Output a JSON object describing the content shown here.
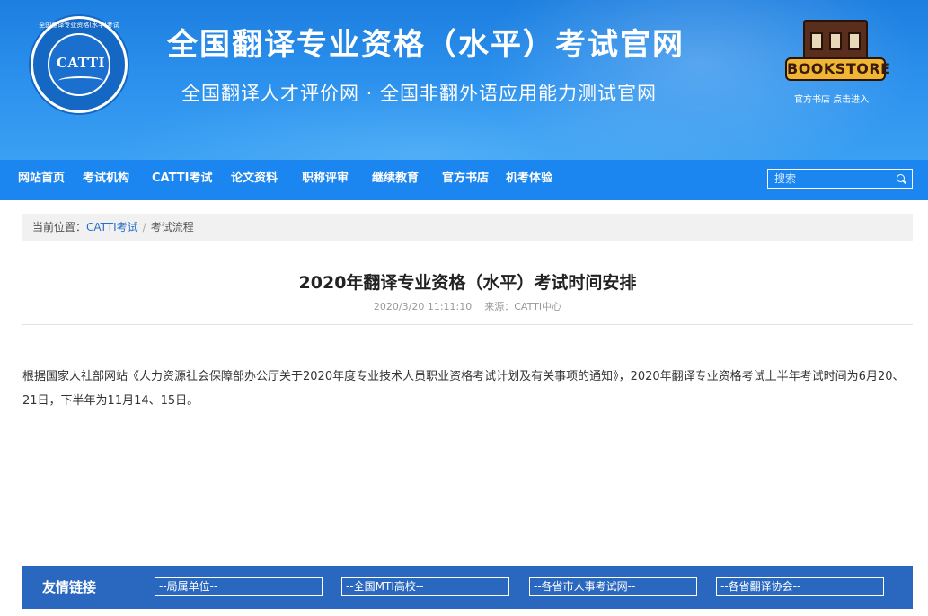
{
  "header": {
    "logo_text": "CATTI",
    "logo_ring_text": "全国翻译专业资格(水平)考试",
    "title": "全国翻译专业资格（水平）考试官网",
    "subtitle": "全国翻译人才评价网 · 全国非翻外语应用能力测试官网",
    "bookstore_sign": "BOOKSTORE",
    "bookstore_caption": "官方书店 点击进入"
  },
  "nav": {
    "items": [
      "网站首页",
      "考试机构",
      "CATTI考试",
      "论文资料",
      "职称评审",
      "继续教育",
      "官方书店",
      "机考体验"
    ],
    "search_placeholder": "搜索"
  },
  "breadcrumb": {
    "prefix": "当前位置：",
    "items": [
      "CATTI考试",
      "考试流程"
    ]
  },
  "article": {
    "title": "2020年翻译专业资格（水平）考试时间安排",
    "date": "2020/3/20 11:11:10",
    "source": "来源：CATTI中心",
    "body": "根据国家人社部网站《人力资源社会保障部办公厅关于2020年度专业技术人员职业资格考试计划及有关事项的通知》，2020年翻译专业资格考试上半年考试时间为6月20、21日，下半年为11月14、15日。"
  },
  "friend_links": {
    "label": "友情链接",
    "selects": [
      "--局属单位--",
      "--全国MTI高校--",
      "--各省市人事考试网--",
      "--各省翻译协会--"
    ]
  },
  "colors": {
    "banner": "#2d92ee",
    "nav": "#1c86f0",
    "footer_bar": "#2a68c0",
    "link": "#2a6ec6"
  }
}
